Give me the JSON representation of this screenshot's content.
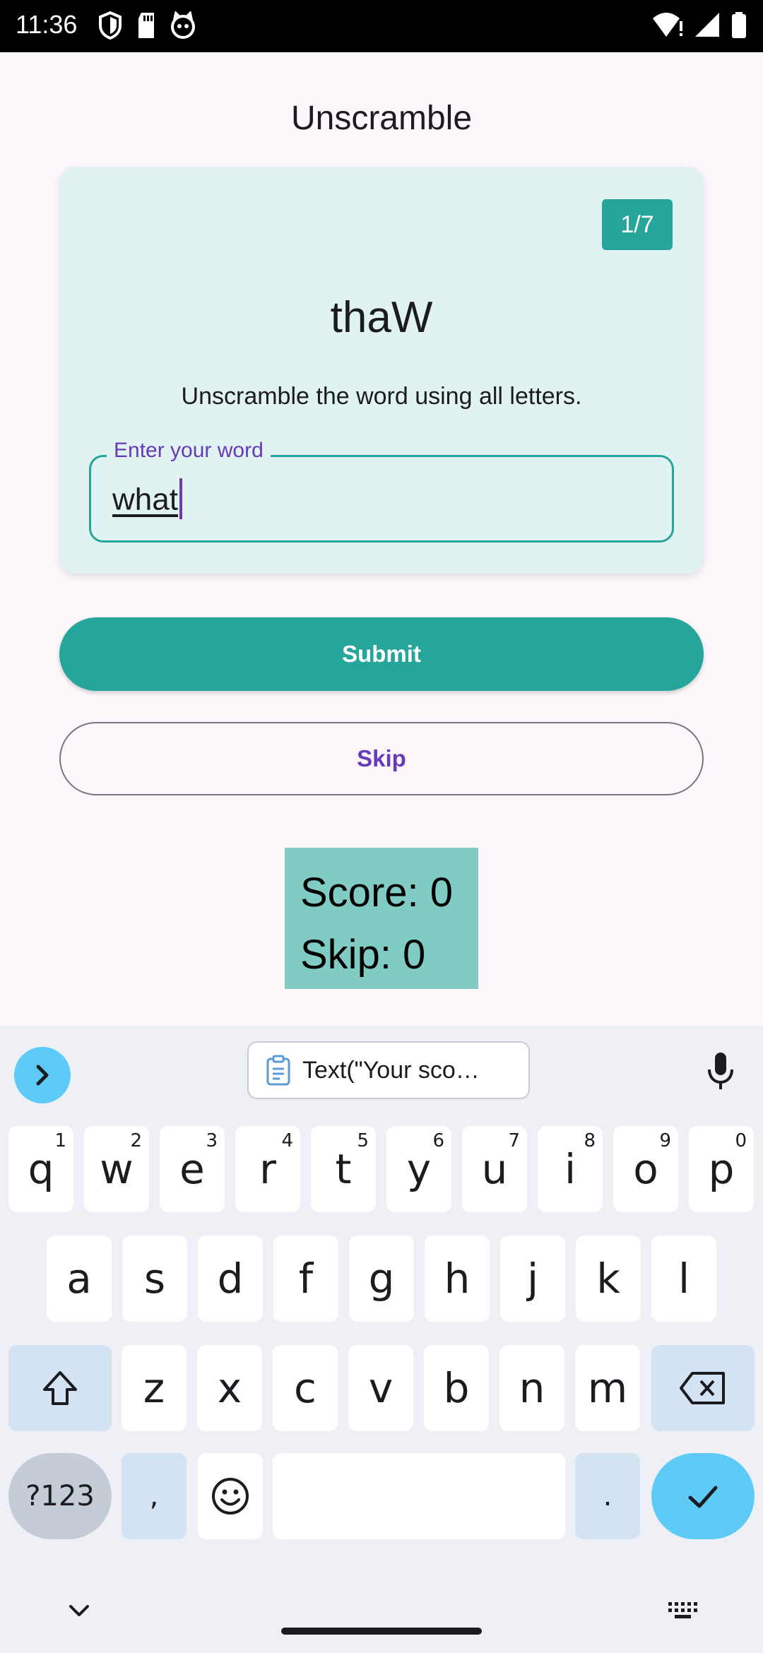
{
  "status_bar": {
    "time": "11:36"
  },
  "app": {
    "title": "Unscramble"
  },
  "card": {
    "counter": "1/7",
    "scrambled_word": "thaW",
    "instruction": "Unscramble the word using all letters.",
    "input_label": "Enter your word",
    "input_value": "what"
  },
  "buttons": {
    "submit": "Submit",
    "skip": "Skip"
  },
  "score": {
    "score_text": "Score: 0",
    "skip_text": "Skip: 0"
  },
  "keyboard": {
    "clipboard_suggestion": "Text(\"Your sco…",
    "row1": [
      {
        "key": "q",
        "hint": "1"
      },
      {
        "key": "w",
        "hint": "2"
      },
      {
        "key": "e",
        "hint": "3"
      },
      {
        "key": "r",
        "hint": "4"
      },
      {
        "key": "t",
        "hint": "5"
      },
      {
        "key": "y",
        "hint": "6"
      },
      {
        "key": "u",
        "hint": "7"
      },
      {
        "key": "i",
        "hint": "8"
      },
      {
        "key": "o",
        "hint": "9"
      },
      {
        "key": "p",
        "hint": "0"
      }
    ],
    "row2": [
      "a",
      "s",
      "d",
      "f",
      "g",
      "h",
      "j",
      "k",
      "l"
    ],
    "row3": [
      "z",
      "x",
      "c",
      "v",
      "b",
      "n",
      "m"
    ],
    "symbols_key": "?123",
    "comma_key": ",",
    "period_key": "."
  },
  "colors": {
    "accent": "#26a69a",
    "label_purple": "#673ab7",
    "card_bg": "#e0f2f1",
    "score_bg": "#80cbc4"
  }
}
